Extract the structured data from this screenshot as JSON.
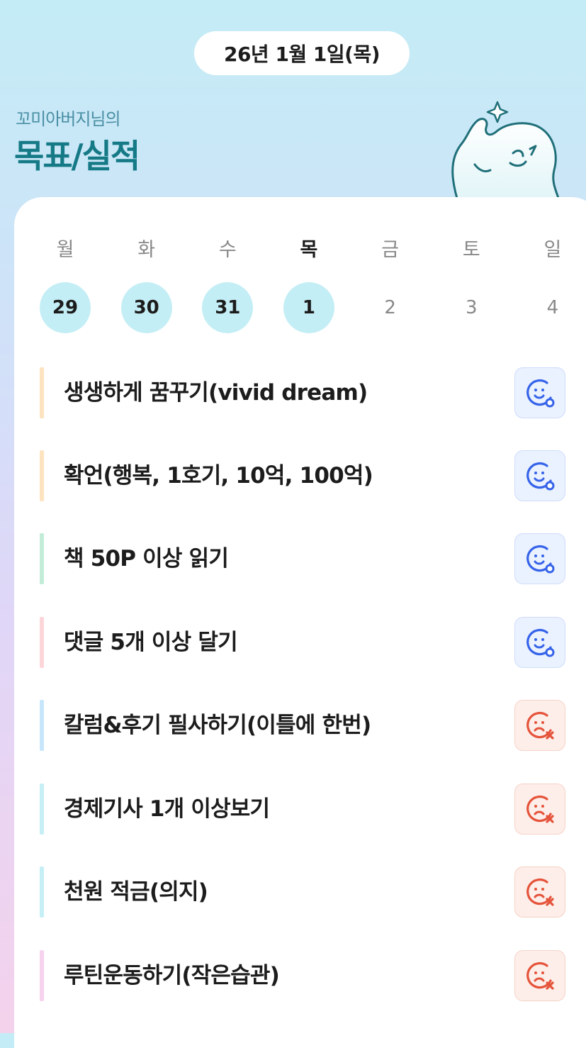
{
  "header": {
    "date": "26년 1월 1일(목)",
    "owner": "꼬미아버지님의",
    "title": "목표/실적"
  },
  "calendar": {
    "weekdays": [
      "월",
      "화",
      "수",
      "목",
      "금",
      "토",
      "일"
    ],
    "days": [
      {
        "num": "29",
        "state": "done"
      },
      {
        "num": "30",
        "state": "done"
      },
      {
        "num": "31",
        "state": "done"
      },
      {
        "num": "1",
        "state": "done"
      },
      {
        "num": "2",
        "state": "future"
      },
      {
        "num": "3",
        "state": "future"
      },
      {
        "num": "4",
        "state": "future"
      }
    ],
    "today_weekday": "목"
  },
  "goals": [
    {
      "label": "생생하게 꿈꾸기(vivid dream)",
      "bar_color": "#fde3bf",
      "status": "done",
      "icon": "smile-check-icon"
    },
    {
      "label": "확언(행복, 1호기, 10억, 100억)",
      "bar_color": "#fde3bf",
      "status": "done",
      "icon": "smile-check-icon"
    },
    {
      "label": "책 50P 이상 읽기",
      "bar_color": "#c2ecd8",
      "status": "done",
      "icon": "smile-check-icon"
    },
    {
      "label": "댓글 5개 이상 달기",
      "bar_color": "#fcd6d8",
      "status": "done",
      "icon": "smile-check-icon"
    },
    {
      "label": "칼럼&후기 필사하기(이틀에 한번)",
      "bar_color": "#c8e6fb",
      "status": "missed",
      "icon": "frown-x-icon"
    },
    {
      "label": "경제기사 1개 이상보기",
      "bar_color": "#c6eef5",
      "status": "missed",
      "icon": "frown-x-icon"
    },
    {
      "label": "천원 적금(의지)",
      "bar_color": "#c6eef5",
      "status": "missed",
      "icon": "frown-x-icon"
    },
    {
      "label": "루틴운동하기(작은습관)",
      "bar_color": "#f6d2ee",
      "status": "missed",
      "icon": "frown-x-icon"
    }
  ],
  "colors": {
    "done_icon": "#3563e9",
    "missed_icon": "#e5533a",
    "title": "#157a86",
    "mascot_outline": "#1f6f79"
  }
}
